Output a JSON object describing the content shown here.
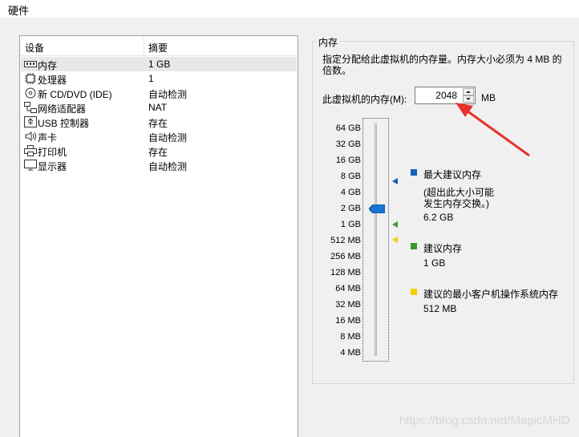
{
  "window": {
    "title": "硬件"
  },
  "devices": {
    "headers": {
      "device": "设备",
      "summary": "摘要"
    },
    "items": [
      {
        "icon": "memory-icon",
        "name": "内存",
        "summary": "1 GB",
        "selected": true
      },
      {
        "icon": "processor-icon",
        "name": "处理器",
        "summary": "1"
      },
      {
        "icon": "cd-dvd-icon",
        "name": "新 CD/DVD (IDE)",
        "summary": "自动检测"
      },
      {
        "icon": "network-adapter-icon",
        "name": "网络适配器",
        "summary": "NAT"
      },
      {
        "icon": "usb-icon",
        "name": "USB 控制器",
        "summary": "存在"
      },
      {
        "icon": "sound-card-icon",
        "name": "声卡",
        "summary": "自动检测"
      },
      {
        "icon": "printer-icon",
        "name": "打印机",
        "summary": "存在"
      },
      {
        "icon": "display-icon",
        "name": "显示器",
        "summary": "自动检测"
      }
    ]
  },
  "memory": {
    "group_title": "内存",
    "description": "指定分配给此虚拟机的内存量。内存大小必须为 4 MB 的倍数。",
    "field_label": "此虚拟机的内存(M):",
    "value": "2048",
    "unit": "MB",
    "scale": [
      "64 GB",
      "32 GB",
      "16 GB",
      "8 GB",
      "4 GB",
      "2 GB",
      "1 GB",
      "512 MB",
      "256 MB",
      "128 MB",
      "64 MB",
      "32 MB",
      "16 MB",
      "8 MB",
      "4 MB"
    ],
    "legend": {
      "max": {
        "label": "最大建议内存",
        "note_line1": "(超出此大小可能",
        "note_line2": "发生内存交换。)",
        "value": "6.2 GB",
        "color": "#1560bd"
      },
      "recommended": {
        "label": "建议内存",
        "value": "1 GB",
        "color": "#3c9a2e"
      },
      "min_guest": {
        "label": "建议的最小客户机操作系统内存",
        "value": "512 MB",
        "color": "#f0d000"
      }
    }
  },
  "watermark": "https://blog.csdn.net/MagicMHD"
}
